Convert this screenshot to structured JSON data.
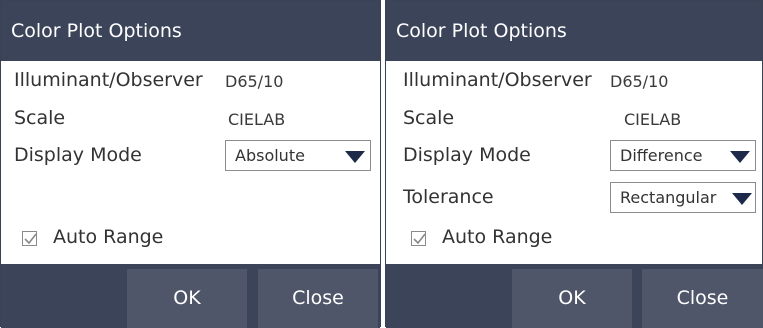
{
  "left_dialog": {
    "title": "Color Plot Options",
    "illuminant_label": "Illuminant/Observer",
    "illuminant_value": "D65/10",
    "scale_label": "Scale",
    "scale_value": "CIELAB",
    "display_mode_label": "Display Mode",
    "display_mode_value": "Absolute",
    "auto_range_label": "Auto Range",
    "auto_range_checked": true,
    "ok_label": "OK",
    "close_label": "Close"
  },
  "right_dialog": {
    "title": "Color Plot Options",
    "illuminant_label": "Illuminant/Observer",
    "illuminant_value": "D65/10",
    "scale_label": "Scale",
    "scale_value": "CIELAB",
    "display_mode_label": "Display Mode",
    "display_mode_value": "Difference",
    "tolerance_label": "Tolerance",
    "tolerance_value": "Rectangular",
    "auto_range_label": "Auto Range",
    "auto_range_checked": true,
    "ok_label": "OK",
    "close_label": "Close"
  },
  "colors": {
    "title_bar": "#3c4459",
    "button": "#4f566a",
    "dropdown_arrow": "#1e2a4a"
  },
  "icons": {
    "dropdown": "triangle-down-icon",
    "checkbox": "checkmark-icon"
  }
}
